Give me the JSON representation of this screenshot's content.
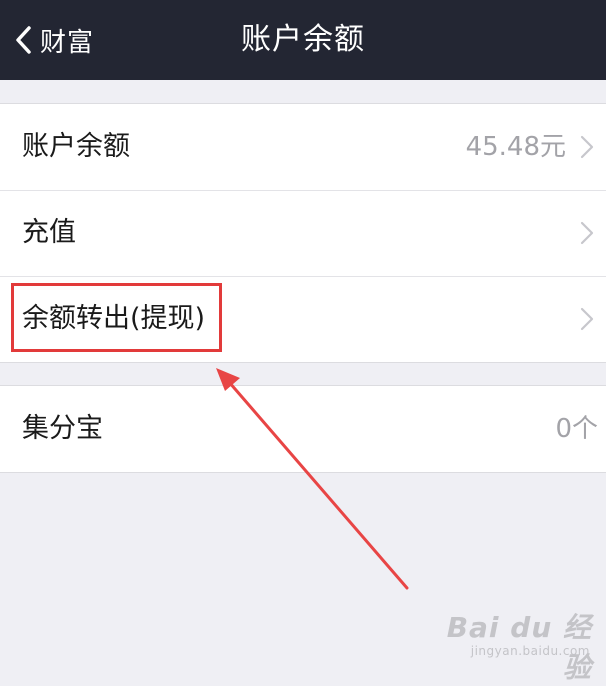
{
  "navbar": {
    "back_label": "财富",
    "title": "账户余额",
    "background_color": "#232633"
  },
  "group1": {
    "rows": [
      {
        "label": "账户余额",
        "value": "45.48元"
      },
      {
        "label": "充值"
      },
      {
        "label": "余额转出(提现)"
      }
    ]
  },
  "group2": {
    "rows": [
      {
        "label": "集分宝",
        "value": "0个"
      }
    ]
  },
  "annotation": {
    "highlight_color": "#e23a3a",
    "highlighted_item": "余额转出(提现)"
  },
  "watermark": {
    "brand": "Bai du 经验",
    "url": "jingyan.baidu.com"
  }
}
